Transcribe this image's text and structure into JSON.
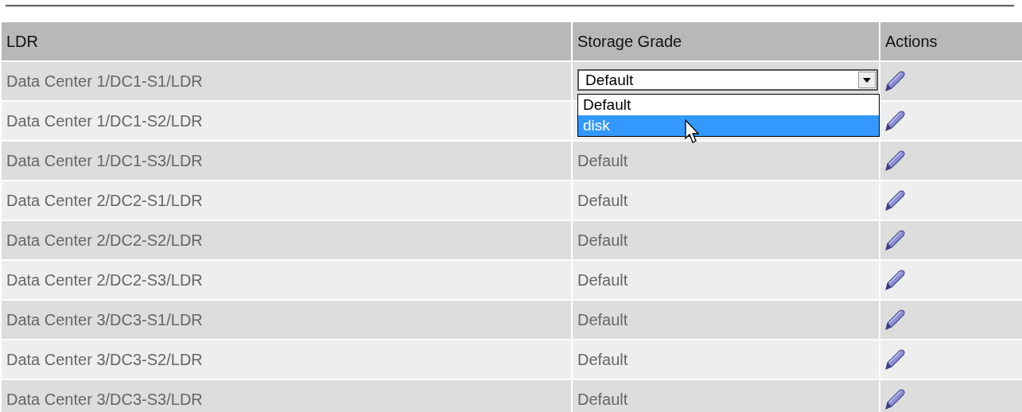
{
  "table": {
    "columns": [
      "LDR",
      "Storage Grade",
      "Actions"
    ],
    "rows": [
      {
        "ldr": "Data Center 1/DC1-S1/LDR",
        "storage_grade": {
          "kind": "dropdown",
          "value": "Default",
          "expanded": true,
          "options": [
            {
              "label": "Default",
              "highlighted": false
            },
            {
              "label": "disk",
              "highlighted": true
            }
          ]
        }
      },
      {
        "ldr": "Data Center 1/DC1-S2/LDR"
      },
      {
        "ldr": "Data Center 1/DC1-S3/LDR",
        "storage_grade": {
          "kind": "text",
          "value": "Default"
        }
      },
      {
        "ldr": "Data Center 2/DC2-S1/LDR",
        "storage_grade": {
          "kind": "text",
          "value": "Default"
        }
      },
      {
        "ldr": "Data Center 2/DC2-S2/LDR",
        "storage_grade": {
          "kind": "text",
          "value": "Default"
        }
      },
      {
        "ldr": "Data Center 2/DC2-S3/LDR",
        "storage_grade": {
          "kind": "text",
          "value": "Default"
        }
      },
      {
        "ldr": "Data Center 3/DC3-S1/LDR",
        "storage_grade": {
          "kind": "text",
          "value": "Default"
        }
      },
      {
        "ldr": "Data Center 3/DC3-S2/LDR",
        "storage_grade": {
          "kind": "text",
          "value": "Default"
        }
      },
      {
        "ldr": "Data Center 3/DC3-S3/LDR",
        "storage_grade": {
          "kind": "text",
          "value": "Default"
        }
      }
    ]
  }
}
